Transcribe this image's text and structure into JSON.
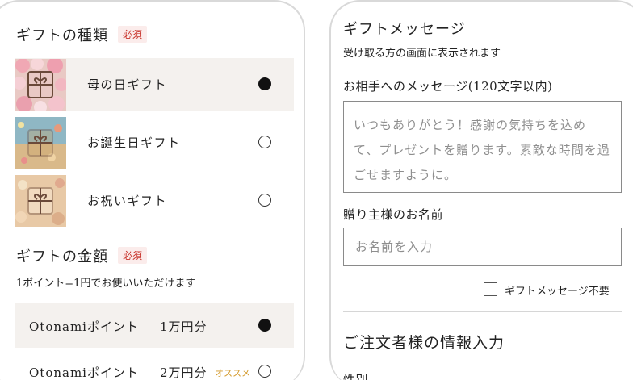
{
  "left": {
    "gift_type": {
      "title": "ギフトの種類",
      "required": "必須",
      "options": [
        {
          "label": "母の日ギフト",
          "selected": true,
          "thumb_icon": "gift-box-icon"
        },
        {
          "label": "お誕生日ギフト",
          "selected": false,
          "thumb_icon": "gift-box-icon"
        },
        {
          "label": "お祝いギフト",
          "selected": false,
          "thumb_icon": "gift-box-icon"
        }
      ]
    },
    "gift_amount": {
      "title": "ギフトの金額",
      "required": "必須",
      "note": "1ポイント=1円でお使いいただけます",
      "options": [
        {
          "label": "Otonamiポイント",
          "value": "1万円分",
          "tag": "",
          "selected": true
        },
        {
          "label": "Otonamiポイント",
          "value": "2万円分",
          "tag": "オススメ",
          "selected": false
        }
      ]
    }
  },
  "right": {
    "gift_message": {
      "title": "ギフトメッセージ",
      "subtitle": "受け取る方の画面に表示されます",
      "message_label": "お相手へのメッセージ(120文字以内)",
      "message_placeholder": "いつもありがとう！感謝の気持ちを込めて、プレゼントを贈ります。素敵な時間を過ごせますように。",
      "sender_label": "贈り主様のお名前",
      "sender_placeholder": "お名前を入力",
      "no_message_label": "ギフトメッセージ不要"
    },
    "orderer": {
      "title": "ご注文者様の情報入力",
      "gender_label": "性別"
    }
  },
  "colors": {
    "required_text": "#c8342c",
    "selected_row_bg": "#f4f1ee",
    "recommend_tag": "#d39a2c",
    "phone_border": "#d9d9d9"
  }
}
